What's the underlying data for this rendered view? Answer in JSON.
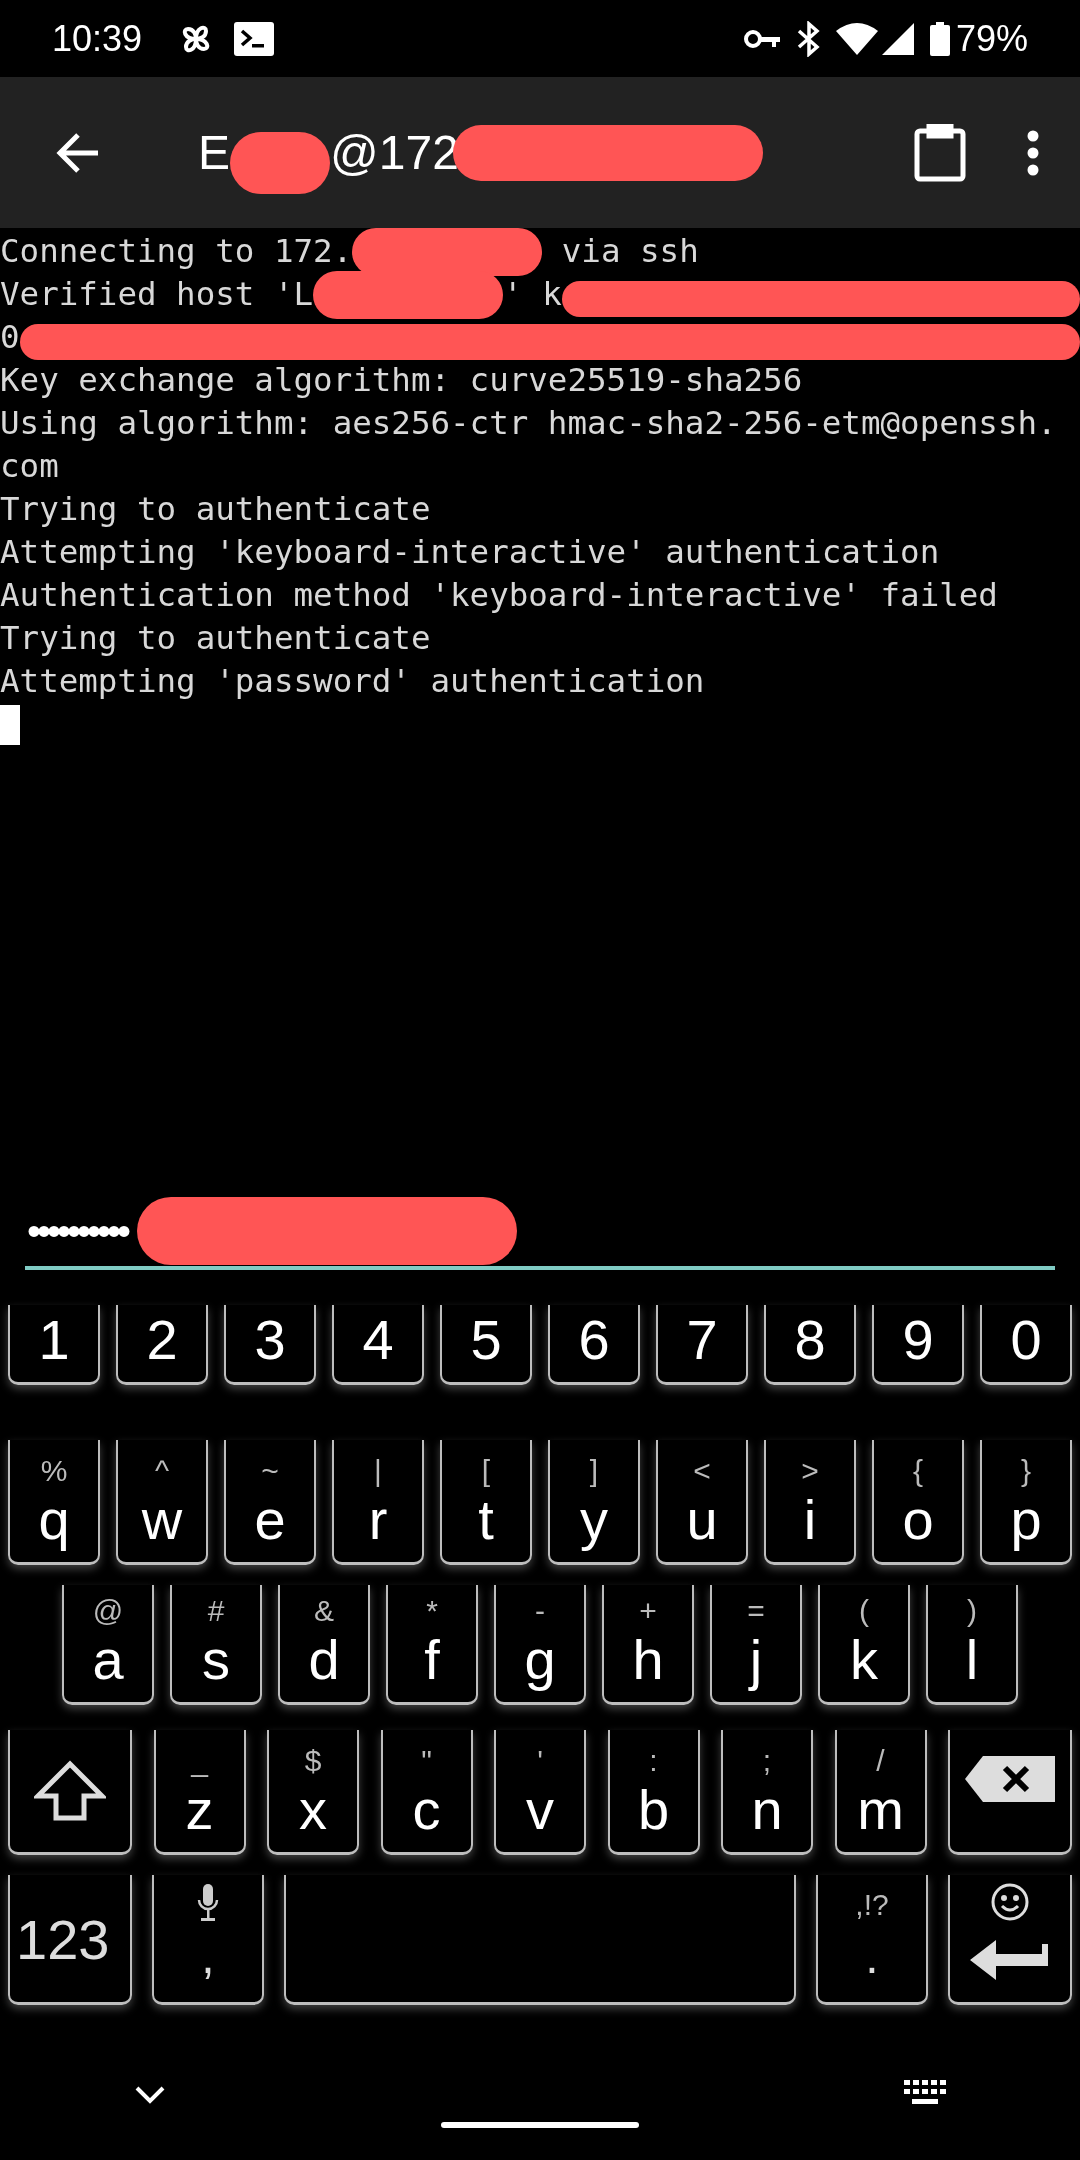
{
  "status_bar": {
    "time": "10:39",
    "battery": "79%"
  },
  "toolbar": {
    "title_parts": [
      {
        "kind": "text",
        "text": "E"
      },
      {
        "kind": "redacted"
      },
      {
        "kind": "text",
        "text": "@172"
      },
      {
        "kind": "redacted"
      }
    ]
  },
  "terminal": {
    "lines": [
      {
        "parts": [
          {
            "kind": "text",
            "text": "Connecting to 172."
          },
          {
            "kind": "redacted"
          },
          {
            "kind": "text",
            "text": " via ssh"
          }
        ]
      },
      {
        "parts": [
          {
            "kind": "text",
            "text": "Verified host 'L"
          },
          {
            "kind": "redacted"
          },
          {
            "kind": "text",
            "text": "' k"
          },
          {
            "kind": "redacted"
          }
        ]
      },
      {
        "parts": [
          {
            "kind": "text",
            "text": "0"
          },
          {
            "kind": "redacted"
          }
        ]
      },
      {
        "parts": [
          {
            "kind": "text",
            "text": "Key exchange algorithm: curve25519-sha256"
          }
        ]
      },
      {
        "parts": [
          {
            "kind": "text",
            "text": "Using algorithm: aes256-ctr hmac-sha2-256-etm@openssh."
          }
        ]
      },
      {
        "parts": [
          {
            "kind": "text",
            "text": "com"
          }
        ]
      },
      {
        "parts": [
          {
            "kind": "text",
            "text": "Trying to authenticate"
          }
        ]
      },
      {
        "parts": [
          {
            "kind": "text",
            "text": "Attempting 'keyboard-interactive' authentication"
          }
        ]
      },
      {
        "parts": [
          {
            "kind": "text",
            "text": "Authentication method 'keyboard-interactive' failed"
          }
        ]
      },
      {
        "parts": [
          {
            "kind": "text",
            "text": "Trying to authenticate"
          }
        ]
      },
      {
        "parts": [
          {
            "kind": "text",
            "text": "Attempting 'password' authentication"
          }
        ]
      }
    ],
    "cursor": true
  },
  "password_field": {
    "parts": [
      {
        "kind": "text",
        "text": "••••••••••"
      },
      {
        "kind": "redacted"
      }
    ]
  },
  "keyboard": {
    "rows": [
      [
        {
          "kind": "char",
          "label": "1"
        },
        {
          "kind": "char",
          "label": "2"
        },
        {
          "kind": "char",
          "label": "3"
        },
        {
          "kind": "char",
          "label": "4"
        },
        {
          "kind": "char",
          "label": "5"
        },
        {
          "kind": "char",
          "label": "6"
        },
        {
          "kind": "char",
          "label": "7"
        },
        {
          "kind": "char",
          "label": "8"
        },
        {
          "kind": "char",
          "label": "9"
        },
        {
          "kind": "char",
          "label": "0"
        }
      ],
      [
        {
          "kind": "char",
          "label": "q",
          "hint": "%"
        },
        {
          "kind": "char",
          "label": "w",
          "hint": "^"
        },
        {
          "kind": "char",
          "label": "e",
          "hint": "~"
        },
        {
          "kind": "char",
          "label": "r",
          "hint": "|"
        },
        {
          "kind": "char",
          "label": "t",
          "hint": "["
        },
        {
          "kind": "char",
          "label": "y",
          "hint": "]"
        },
        {
          "kind": "char",
          "label": "u",
          "hint": "<"
        },
        {
          "kind": "char",
          "label": "i",
          "hint": ">"
        },
        {
          "kind": "char",
          "label": "o",
          "hint": "{"
        },
        {
          "kind": "char",
          "label": "p",
          "hint": "}"
        }
      ],
      [
        {
          "kind": "char",
          "label": "a",
          "hint": "@"
        },
        {
          "kind": "char",
          "label": "s",
          "hint": "#"
        },
        {
          "kind": "char",
          "label": "d",
          "hint": "&"
        },
        {
          "kind": "char",
          "label": "f",
          "hint": "*"
        },
        {
          "kind": "char",
          "label": "g",
          "hint": "-"
        },
        {
          "kind": "char",
          "label": "h",
          "hint": "+"
        },
        {
          "kind": "char",
          "label": "j",
          "hint": "="
        },
        {
          "kind": "char",
          "label": "k",
          "hint": "("
        },
        {
          "kind": "char",
          "label": "l",
          "hint": ")"
        }
      ],
      [
        {
          "kind": "shift"
        },
        {
          "kind": "char",
          "label": "z",
          "hint": "_"
        },
        {
          "kind": "char",
          "label": "x",
          "hint": "$"
        },
        {
          "kind": "char",
          "label": "c",
          "hint": "\""
        },
        {
          "kind": "char",
          "label": "v",
          "hint": "'"
        },
        {
          "kind": "char",
          "label": "b",
          "hint": ":"
        },
        {
          "kind": "char",
          "label": "n",
          "hint": ";"
        },
        {
          "kind": "char",
          "label": "m",
          "hint": "/"
        },
        {
          "kind": "backspace"
        }
      ],
      [
        {
          "kind": "symbols",
          "label": "123"
        },
        {
          "kind": "comma",
          "label": ","
        },
        {
          "kind": "space"
        },
        {
          "kind": "period",
          "label": ".",
          "hint": ",!?"
        },
        {
          "kind": "enter"
        }
      ]
    ]
  }
}
